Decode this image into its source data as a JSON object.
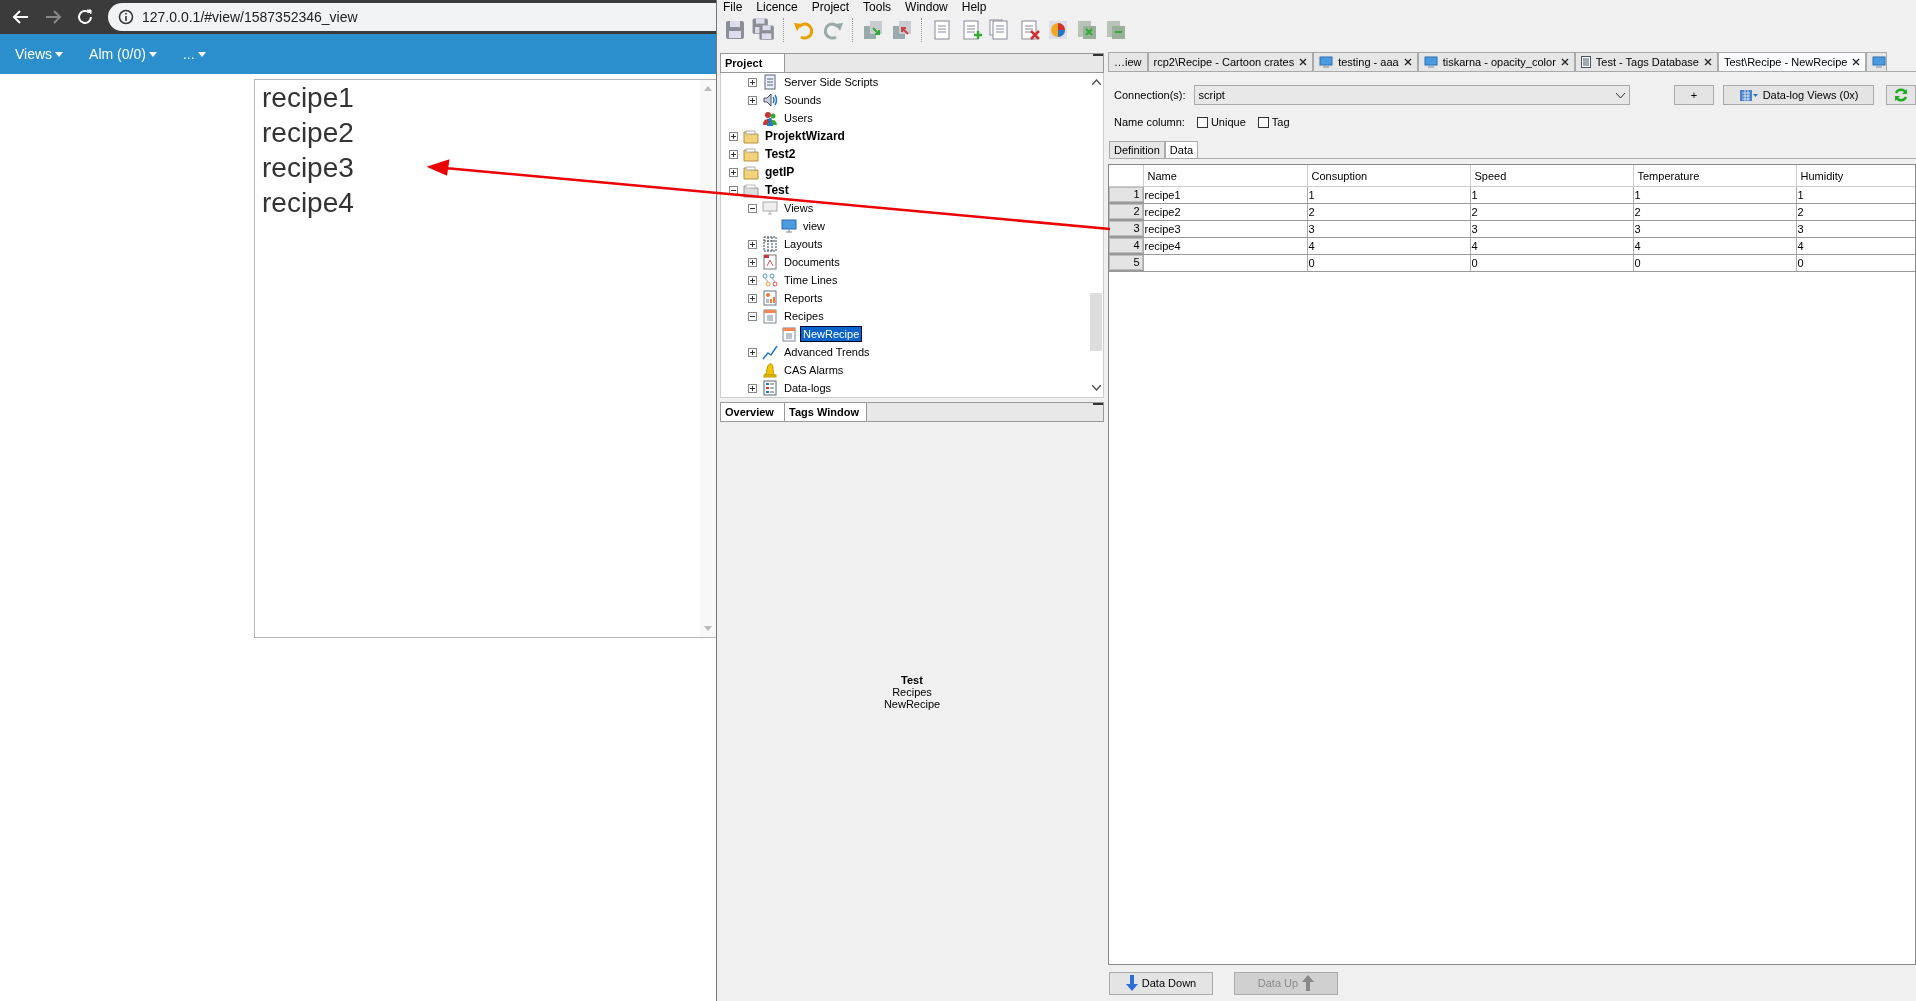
{
  "browser": {
    "url": "127.0.0.1/#view/1587352346_view",
    "nav": [
      {
        "label": "Views"
      },
      {
        "label": "Alm (0/0)"
      },
      {
        "label": "..."
      }
    ],
    "list": [
      "recipe1",
      "recipe2",
      "recipe3",
      "recipe4"
    ]
  },
  "app": {
    "menu": [
      "File",
      "Licence",
      "Project",
      "Tools",
      "Window",
      "Help"
    ],
    "project_panel": {
      "title": "Project",
      "orphan_items": [
        {
          "label": "Server Side Scripts",
          "kind": "script",
          "expanded": false,
          "selected": false
        },
        {
          "label": "Sounds",
          "kind": "sound",
          "expanded": false,
          "selected": false
        },
        {
          "label": "Users",
          "kind": "users",
          "selected": false
        }
      ],
      "items": [
        {
          "label": "ProjektWizard",
          "kind": "folder",
          "expanded": false,
          "selected": false
        },
        {
          "label": "Test2",
          "kind": "folder",
          "expanded": false,
          "selected": false
        },
        {
          "label": "getIP",
          "kind": "folder",
          "expanded": false,
          "selected": false
        },
        {
          "label": "Test",
          "kind": "project",
          "expanded": true,
          "selected": false,
          "children": [
            {
              "label": "Views",
              "kind": "views",
              "expanded": true,
              "selected": false,
              "children": [
                {
                  "label": "view",
                  "kind": "view",
                  "selected": false
                }
              ]
            },
            {
              "label": "Layouts",
              "kind": "layouts",
              "expanded": false,
              "selected": false
            },
            {
              "label": "Documents",
              "kind": "documents",
              "expanded": false,
              "selected": false
            },
            {
              "label": "Time Lines",
              "kind": "timeline",
              "expanded": false,
              "selected": false
            },
            {
              "label": "Reports",
              "kind": "report",
              "expanded": false,
              "selected": false
            },
            {
              "label": "Recipes",
              "kind": "recipe",
              "expanded": true,
              "selected": false,
              "children": [
                {
                  "label": "NewRecipe",
                  "kind": "recipe",
                  "selected": true
                }
              ]
            },
            {
              "label": "Advanced Trends",
              "kind": "trend",
              "expanded": false,
              "selected": false
            },
            {
              "label": "CAS Alarms",
              "kind": "alarm",
              "selected": false
            },
            {
              "label": "Data-logs",
              "kind": "datalog",
              "expanded": false,
              "selected": false
            }
          ]
        }
      ]
    },
    "bottom_panel": {
      "tabs": [
        "Overview",
        "Tags Window"
      ],
      "overview": {
        "title": "Test",
        "lines": [
          "Recipes",
          "NewRecipe"
        ]
      }
    },
    "editor": {
      "tabs": [
        {
          "label": "…iew",
          "closable": false,
          "selected": false
        },
        {
          "label": "rcp2\\Recipe - Cartoon crates",
          "closable": true,
          "selected": false
        },
        {
          "label": "testing - aaa",
          "kind": "view",
          "closable": true,
          "selected": false
        },
        {
          "label": "tiskarna - opacity_color",
          "kind": "view",
          "closable": true,
          "selected": false
        },
        {
          "label": "Test - Tags Database",
          "kind": "tags",
          "closable": true,
          "selected": false
        },
        {
          "label": "Test\\Recipe - NewRecipe",
          "closable": true,
          "selected": true
        }
      ],
      "connection_label": "Connection(s):",
      "connection_value": "script",
      "add_button": "+",
      "datalog_button": "Data-log Views (0x)",
      "name_column_label": "Name column:",
      "checkboxes": [
        {
          "label": "Unique",
          "checked": false
        },
        {
          "label": "Tag",
          "checked": false
        }
      ],
      "subtabs": [
        {
          "label": "Definition",
          "selected": false
        },
        {
          "label": "Data",
          "selected": true
        }
      ],
      "table": {
        "columns": [
          "Name",
          "Consuption",
          "Speed",
          "Temperature",
          "Humidity"
        ],
        "rows": [
          {
            "number": "1",
            "cells": [
              "recipe1",
              "1",
              "1",
              "1",
              "1"
            ]
          },
          {
            "number": "2",
            "cells": [
              "recipe2",
              "2",
              "2",
              "2",
              "2"
            ]
          },
          {
            "number": "3",
            "cells": [
              "recipe3",
              "3",
              "3",
              "3",
              "3"
            ]
          },
          {
            "number": "4",
            "cells": [
              "recipe4",
              "4",
              "4",
              "4",
              "4"
            ]
          },
          {
            "number": "5",
            "cells": [
              null,
              "0",
              "0",
              "0",
              "0"
            ]
          }
        ]
      },
      "buttons": [
        {
          "label": "Data Down",
          "kind": "down",
          "disabled": false
        },
        {
          "label": "Data Up",
          "kind": "up",
          "disabled": true
        }
      ]
    }
  }
}
